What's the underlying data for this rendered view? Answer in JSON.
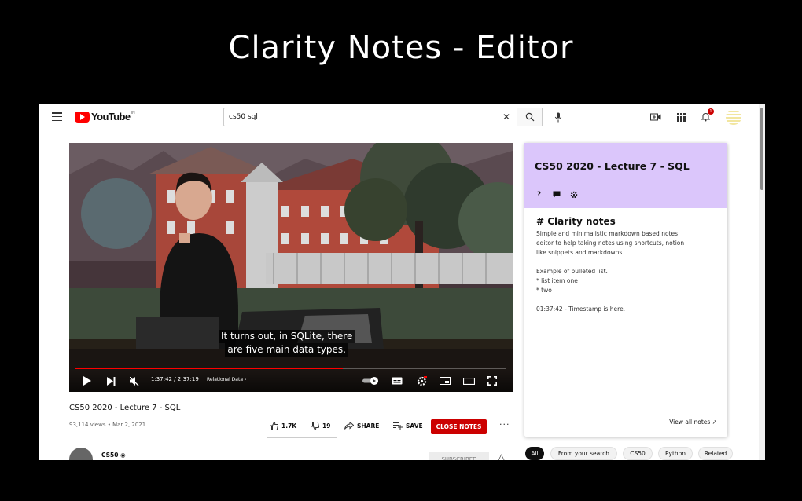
{
  "banner": {
    "title": "Clarity Notes - Editor"
  },
  "header": {
    "logo_text": "YouTube",
    "logo_region": "IN",
    "search_value": "cs50 sql",
    "notification_count": "1"
  },
  "player": {
    "caption_line1": "It turns out, in SQLite, there",
    "caption_line2": "are five main data types.",
    "time": "1:37:42 / 2:37:19",
    "chapter": "Relational Data",
    "progress_fraction": 0.62
  },
  "video": {
    "title": "CS50 2020 - Lecture 7 - SQL",
    "meta": "93,114 views • Mar 2, 2021",
    "likes": "1.7K",
    "dislikes": "19",
    "share_label": "SHARE",
    "save_label": "SAVE",
    "close_notes_label": "CLOSE NOTES",
    "channel_name": "CS50",
    "subscribe_label": "SUBSCRIBED"
  },
  "notes": {
    "title": "CS50 2020 - Lecture 7 - SQL",
    "heading": "# Clarity notes",
    "paragraph1_line1": "Simple and minimalistic markdown based notes",
    "paragraph1_line2": "editor to help taking notes using shortcuts, notion",
    "paragraph1_line3": "like snippets and markdowns.",
    "list_intro": "Example of bulleted list.",
    "list_item1": "* list item one",
    "list_item2": "* two",
    "timestamp_line": "01:37:42 - Timestamp is here.",
    "view_all": "View all notes ↗"
  },
  "chips": [
    "All",
    "From your search",
    "CS50",
    "Python",
    "Related"
  ],
  "colors": {
    "accent_red": "#cc0000",
    "notes_header": "#dbc6fb"
  }
}
